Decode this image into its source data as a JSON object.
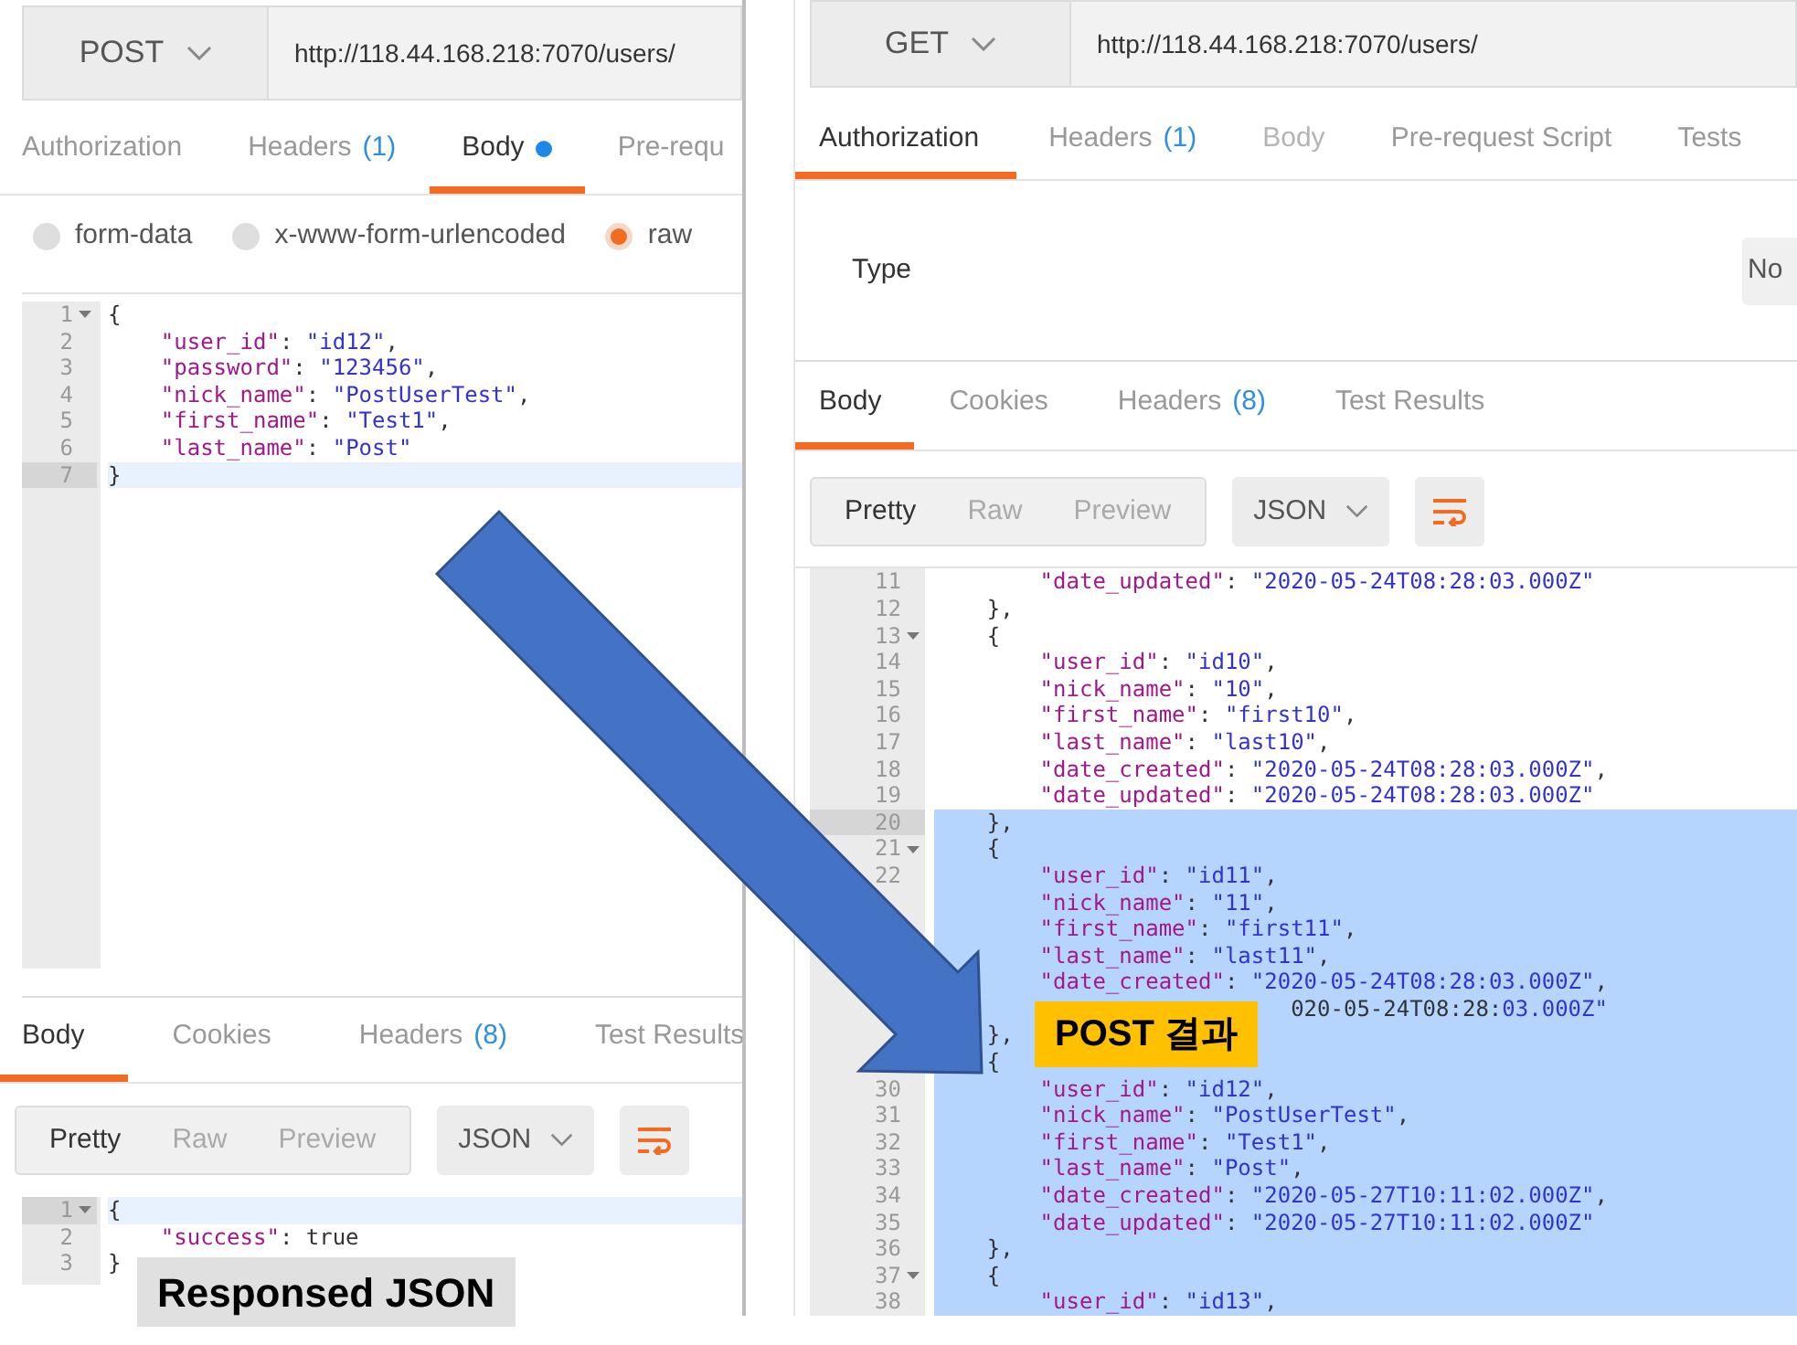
{
  "left": {
    "method": "POST",
    "url": "http://118.44.168.218:7070/users/",
    "request_tabs": [
      {
        "label": "Authorization",
        "selected": false
      },
      {
        "label": "Headers",
        "count": "(1)",
        "selected": false
      },
      {
        "label": "Body",
        "selected": true,
        "dot": true
      },
      {
        "label": "Pre-requ",
        "selected": false
      }
    ],
    "body_types": [
      {
        "label": "form-data",
        "selected": false
      },
      {
        "label": "x-www-form-urlencoded",
        "selected": false
      },
      {
        "label": "raw",
        "selected": true
      }
    ],
    "request_code": [
      {
        "n": "1",
        "text": "{",
        "fold": true,
        "active": false
      },
      {
        "n": "2",
        "text": "    \"user_id\": \"id12\",",
        "fold": false,
        "active": false
      },
      {
        "n": "3",
        "text": "    \"password\": \"123456\",",
        "fold": false,
        "active": false
      },
      {
        "n": "4",
        "text": "    \"nick_name\": \"PostUserTest\",",
        "fold": false,
        "active": false
      },
      {
        "n": "5",
        "text": "    \"first_name\": \"Test1\",",
        "fold": false,
        "active": false
      },
      {
        "n": "6",
        "text": "    \"last_name\": \"Post\"",
        "fold": false,
        "active": false
      },
      {
        "n": "7",
        "text": "}",
        "fold": false,
        "active": true
      }
    ],
    "response_tabs": [
      {
        "label": "Body",
        "selected": true
      },
      {
        "label": "Cookies",
        "selected": false
      },
      {
        "label": "Headers",
        "count": "(8)",
        "selected": false
      },
      {
        "label": "Test Results",
        "selected": false
      }
    ],
    "view_modes": [
      {
        "label": "Pretty",
        "selected": true
      },
      {
        "label": "Raw",
        "selected": false
      },
      {
        "label": "Preview",
        "selected": false
      }
    ],
    "format": "JSON",
    "response_code": [
      {
        "n": "1",
        "text": "{",
        "fold": true,
        "active": true
      },
      {
        "n": "2",
        "text": "    \"success\": true",
        "fold": false,
        "active": false
      },
      {
        "n": "3",
        "text": "}",
        "fold": false,
        "active": false
      }
    ]
  },
  "right": {
    "method": "GET",
    "url": "http://118.44.168.218:7070/users/",
    "request_tabs": [
      {
        "label": "Authorization",
        "selected": true,
        "disabled": false
      },
      {
        "label": "Headers",
        "count": "(1)",
        "selected": false,
        "disabled": false
      },
      {
        "label": "Body",
        "selected": false,
        "disabled": true
      },
      {
        "label": "Pre-request Script",
        "selected": false,
        "disabled": false
      },
      {
        "label": "Tests",
        "selected": false,
        "disabled": false
      }
    ],
    "type_label": "Type",
    "type_value": "No",
    "response_tabs": [
      {
        "label": "Body",
        "selected": true
      },
      {
        "label": "Cookies",
        "selected": false
      },
      {
        "label": "Headers",
        "count": "(8)",
        "selected": false
      },
      {
        "label": "Test Results",
        "selected": false
      }
    ],
    "view_modes": [
      {
        "label": "Pretty",
        "selected": true
      },
      {
        "label": "Raw",
        "selected": false
      },
      {
        "label": "Preview",
        "selected": false
      }
    ],
    "format": "JSON",
    "response_code": [
      {
        "n": "11",
        "text": "        \"date_updated\": \"2020-05-24T08:28:03.000Z\"",
        "fold": false,
        "selected": false,
        "active": false
      },
      {
        "n": "12",
        "text": "    },",
        "fold": false,
        "selected": false,
        "active": false
      },
      {
        "n": "13",
        "text": "    {",
        "fold": true,
        "selected": false,
        "active": false
      },
      {
        "n": "14",
        "text": "        \"user_id\": \"id10\",",
        "fold": false,
        "selected": false,
        "active": false
      },
      {
        "n": "15",
        "text": "        \"nick_name\": \"10\",",
        "fold": false,
        "selected": false,
        "active": false
      },
      {
        "n": "16",
        "text": "        \"first_name\": \"first10\",",
        "fold": false,
        "selected": false,
        "active": false
      },
      {
        "n": "17",
        "text": "        \"last_name\": \"last10\",",
        "fold": false,
        "selected": false,
        "active": false
      },
      {
        "n": "18",
        "text": "        \"date_created\": \"2020-05-24T08:28:03.000Z\",",
        "fold": false,
        "selected": false,
        "active": false
      },
      {
        "n": "19",
        "text": "        \"date_updated\": \"2020-05-24T08:28:03.000Z\"",
        "fold": false,
        "selected": false,
        "active": false
      },
      {
        "n": "20",
        "text": "    },",
        "fold": false,
        "selected": true,
        "active": true
      },
      {
        "n": "21",
        "text": "    {",
        "fold": true,
        "selected": true,
        "active": false
      },
      {
        "n": "22",
        "text": "        \"user_id\": \"id11\",",
        "fold": false,
        "selected": true,
        "active": false
      },
      {
        "text": "        \"nick_name\": \"11\",",
        "fold": false,
        "selected": true,
        "active": false
      },
      {
        "text": "        \"first_name\": \"first11\",",
        "fold": false,
        "selected": true,
        "active": false
      },
      {
        "text": "        \"last_name\": \"last11\",",
        "fold": false,
        "selected": true,
        "active": false
      },
      {
        "text": "        \"date_created\": \"2020-05-24T08:28:03.000Z\",",
        "fold": false,
        "selected": true,
        "active": false
      },
      {
        "text": "                           020-05-24T08:28:03.000Z\"",
        "fold": false,
        "selected": true,
        "active": false
      },
      {
        "text": "    },",
        "fold": false,
        "selected": true,
        "active": false
      },
      {
        "text": "    {",
        "fold": false,
        "selected": true,
        "active": false
      },
      {
        "n": "30",
        "text": "        \"user_id\": \"id12\",",
        "fold": false,
        "selected": true,
        "active": false
      },
      {
        "n": "31",
        "text": "        \"nick_name\": \"PostUserTest\",",
        "fold": false,
        "selected": true,
        "active": false
      },
      {
        "n": "32",
        "text": "        \"first_name\": \"Test1\",",
        "fold": false,
        "selected": true,
        "active": false
      },
      {
        "n": "33",
        "text": "        \"last_name\": \"Post\",",
        "fold": false,
        "selected": true,
        "active": false
      },
      {
        "n": "34",
        "text": "        \"date_created\": \"2020-05-27T10:11:02.000Z\",",
        "fold": false,
        "selected": true,
        "active": false
      },
      {
        "n": "35",
        "text": "        \"date_updated\": \"2020-05-27T10:11:02.000Z\"",
        "fold": false,
        "selected": true,
        "active": false
      },
      {
        "n": "36",
        "text": "    },",
        "fold": false,
        "selected": true,
        "active": false
      },
      {
        "n": "37",
        "text": "    {",
        "fold": true,
        "selected": true,
        "active": false
      },
      {
        "n": "38",
        "text": "        \"user_id\": \"id13\",",
        "fold": false,
        "selected": true,
        "active": false
      }
    ]
  },
  "annotations": [
    {
      "text": "Responsed JSON",
      "kind": "note"
    },
    {
      "text": "POST 결과",
      "kind": "highlight"
    }
  ]
}
